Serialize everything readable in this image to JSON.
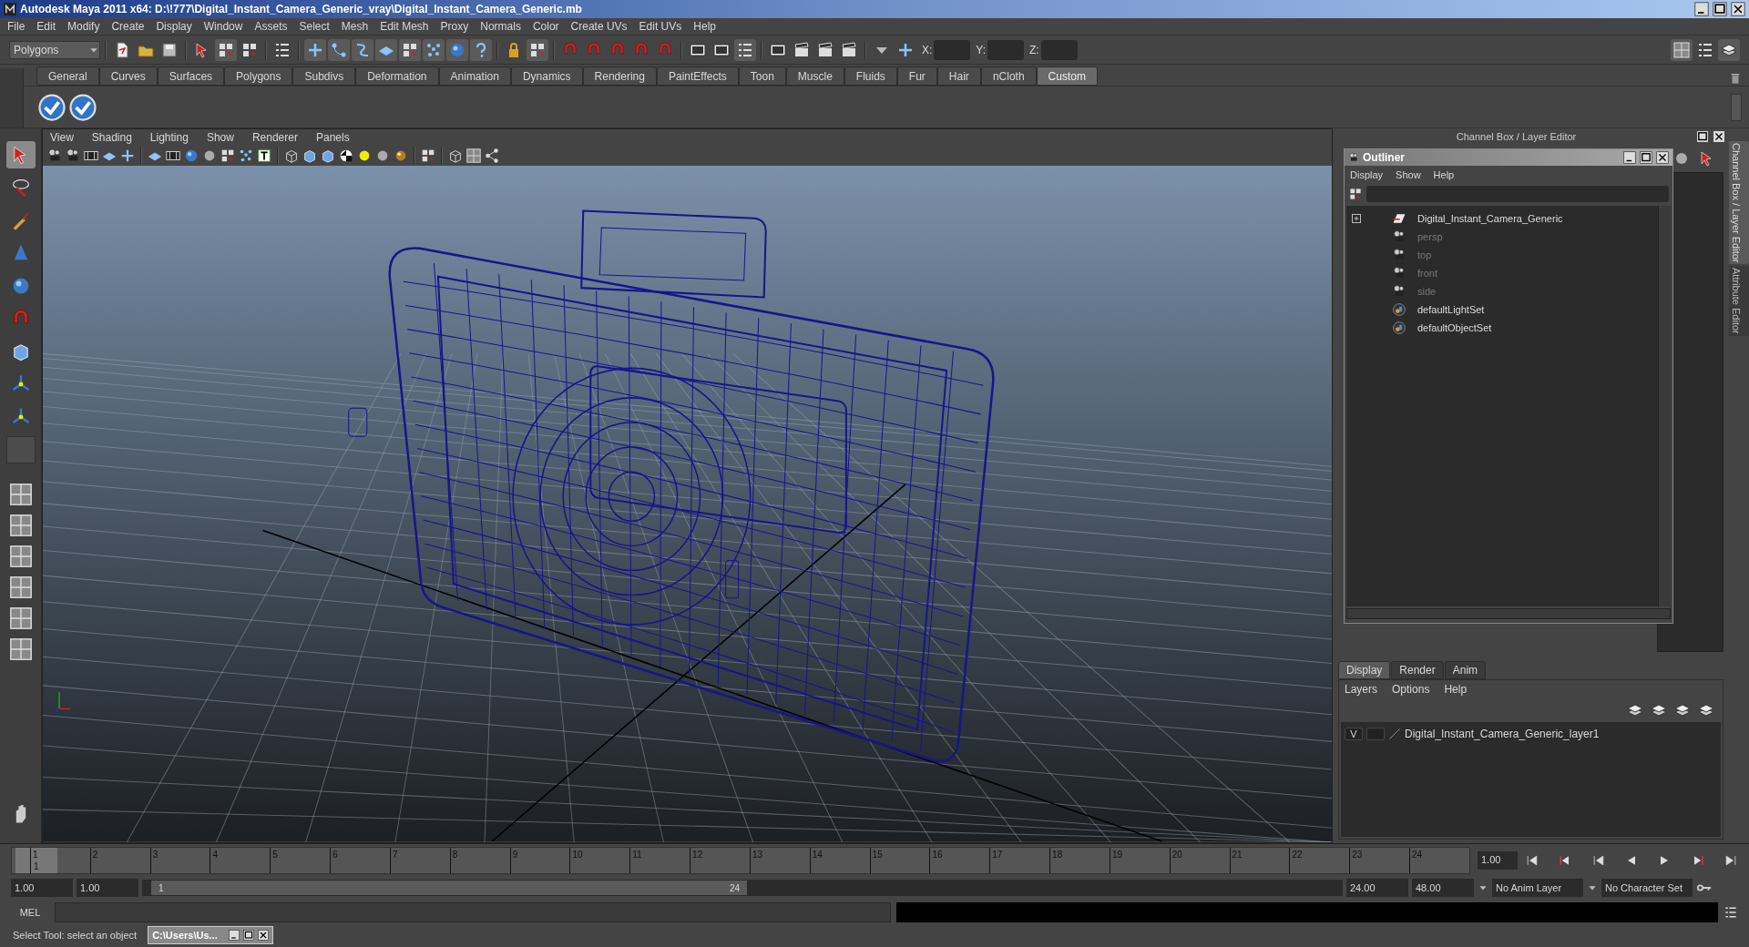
{
  "window": {
    "title": "Autodesk Maya 2011 x64: D:\\!777\\Digital_Instant_Camera_Generic_vray\\Digital_Instant_Camera_Generic.mb"
  },
  "menu_bar": [
    "File",
    "Edit",
    "Modify",
    "Create",
    "Display",
    "Window",
    "Assets",
    "Select",
    "Mesh",
    "Edit Mesh",
    "Proxy",
    "Normals",
    "Color",
    "Create UVs",
    "Edit UVs",
    "Help"
  ],
  "status_line": {
    "menu_set": "Polygons",
    "x_label": "X:",
    "y_label": "Y:",
    "z_label": "Z:"
  },
  "shelf": {
    "tabs": [
      {
        "label": "General",
        "selected": false
      },
      {
        "label": "Curves",
        "selected": false
      },
      {
        "label": "Surfaces",
        "selected": false
      },
      {
        "label": "Polygons",
        "selected": false
      },
      {
        "label": "Subdivs",
        "selected": false
      },
      {
        "label": "Deformation",
        "selected": false
      },
      {
        "label": "Animation",
        "selected": false
      },
      {
        "label": "Dynamics",
        "selected": false
      },
      {
        "label": "Rendering",
        "selected": false
      },
      {
        "label": "PaintEffects",
        "selected": false
      },
      {
        "label": "Toon",
        "selected": false
      },
      {
        "label": "Muscle",
        "selected": false
      },
      {
        "label": "Fluids",
        "selected": false
      },
      {
        "label": "Fur",
        "selected": false
      },
      {
        "label": "Hair",
        "selected": false
      },
      {
        "label": "nCloth",
        "selected": false
      },
      {
        "label": "Custom",
        "selected": true
      }
    ]
  },
  "viewport": {
    "menus": [
      "View",
      "Shading",
      "Lighting",
      "Show",
      "Renderer",
      "Panels"
    ]
  },
  "right_panel": {
    "title": "Channel Box / Layer Editor",
    "side_tabs": [
      {
        "label": "Channel Box / Layer Editor",
        "selected": true
      },
      {
        "label": "Attribute Editor",
        "selected": false
      }
    ]
  },
  "outliner": {
    "title": "Outliner",
    "menus": [
      "Display",
      "Show",
      "Help"
    ],
    "items": [
      {
        "kind": "transform",
        "label": "Digital_Instant_Camera_Generic",
        "dimmed": false,
        "expanded": false
      },
      {
        "kind": "camera",
        "label": "persp",
        "dimmed": true
      },
      {
        "kind": "camera",
        "label": "top",
        "dimmed": true
      },
      {
        "kind": "camera",
        "label": "front",
        "dimmed": true
      },
      {
        "kind": "camera",
        "label": "side",
        "dimmed": true
      },
      {
        "kind": "set",
        "label": "defaultLightSet",
        "dimmed": false
      },
      {
        "kind": "set",
        "label": "defaultObjectSet",
        "dimmed": false
      }
    ]
  },
  "layer_editor": {
    "tabs": [
      {
        "label": "Display",
        "selected": true
      },
      {
        "label": "Render",
        "selected": false
      },
      {
        "label": "Anim",
        "selected": false
      }
    ],
    "menus": [
      "Layers",
      "Options",
      "Help"
    ],
    "layers": [
      {
        "visibility": "V",
        "name": "Digital_Instant_Camera_Generic_layer1"
      }
    ]
  },
  "time_slider": {
    "ticks": [
      "1",
      "2",
      "3",
      "4",
      "5",
      "6",
      "7",
      "8",
      "9",
      "10",
      "11",
      "12",
      "13",
      "14",
      "15",
      "16",
      "17",
      "18",
      "19",
      "20",
      "21",
      "22",
      "23",
      "24"
    ],
    "current_frame": "1",
    "level": 0,
    "current_time": "1.00"
  },
  "range_slider": {
    "start_time": "1.00",
    "playback_start": "1.00",
    "range_start": "1",
    "range_end": "24",
    "playback_end": "24.00",
    "end_time": "48.00",
    "anim_layer": "No Anim Layer",
    "character_set": "No Character Set"
  },
  "command_line": {
    "label": "MEL"
  },
  "help_line": {
    "text": "Select Tool: select an object",
    "task_button": "C:\\Users\\Us..."
  }
}
